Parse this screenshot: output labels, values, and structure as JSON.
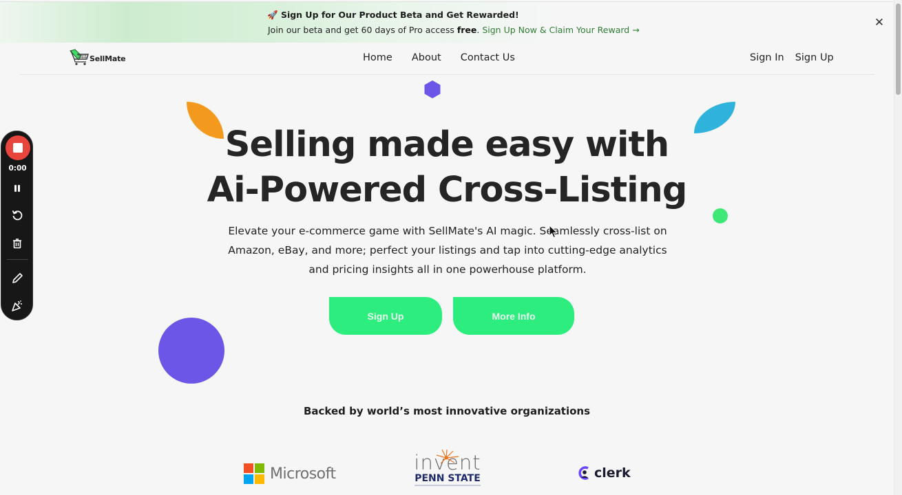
{
  "banner": {
    "emoji": "🚀",
    "headline": "Sign Up for Our Product Beta and Get Rewarded!",
    "body_prefix": "Join our beta and get 60 days of Pro access ",
    "body_bold": "free",
    "body_period": ". ",
    "link_text": "Sign Up Now & Claim Your Reward →",
    "close_icon": "close-icon",
    "close_glyph": "✕"
  },
  "navbar": {
    "logo_text": "SellMate",
    "logo_icon": "shopping-cart-icon",
    "links": [
      {
        "label": "Home"
      },
      {
        "label": "About"
      },
      {
        "label": "Contact Us"
      }
    ],
    "auth": {
      "sign_in": "Sign In",
      "sign_up": "Sign Up"
    }
  },
  "hero": {
    "title_line1": "Selling made easy with",
    "title_line2": "Ai-Powered Cross-Listing",
    "subtitle": "Elevate your e-commerce game with SellMate's AI magic. Seamlessly cross-list on Amazon, eBay, and more; perfect your listings and tap into cutting-edge analytics and pricing insights all in one powerhouse platform.",
    "buttons": {
      "primary": "Sign Up",
      "secondary": "More Info"
    }
  },
  "backers": {
    "title": "Backed by world’s most innovative organizations",
    "partners": [
      {
        "name": "Microsoft"
      },
      {
        "name": "invent",
        "subtitle": "PENN STATE"
      },
      {
        "name": "clerk"
      }
    ]
  },
  "recorder": {
    "time": "0:00",
    "controls": [
      "stop",
      "pause",
      "restart",
      "delete",
      "draw",
      "effects"
    ]
  },
  "colors": {
    "accent_green": "#2ced7d",
    "link_green": "#2f7d32",
    "purple": "#6c56e8",
    "orange": "#f39a1e",
    "blue": "#2fb3dc",
    "record_red": "#e8453c"
  }
}
